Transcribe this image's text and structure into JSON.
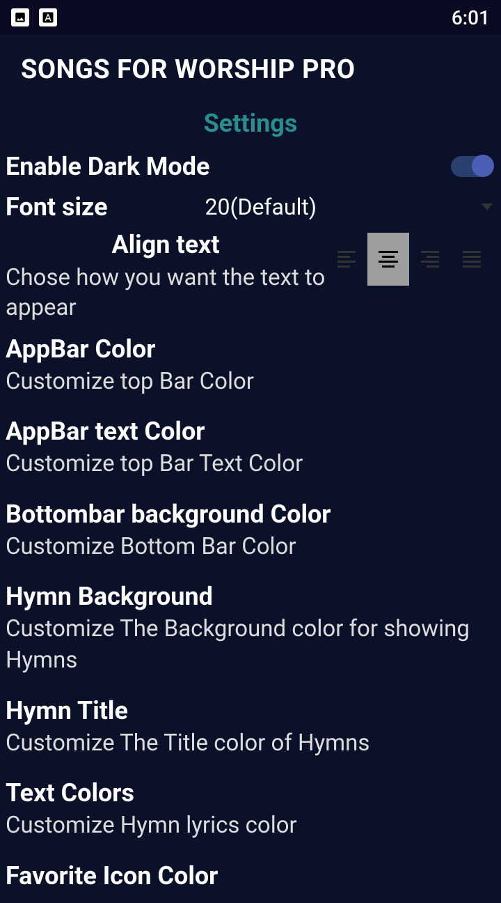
{
  "status": {
    "time": "6:01"
  },
  "app_title": "SONGS FOR WORSHIP PRO",
  "page_title": "Settings",
  "dark_mode": {
    "label": "Enable Dark Mode",
    "enabled": true
  },
  "font_size": {
    "label": "Font size",
    "value": "20(Default)"
  },
  "align": {
    "title": "Align text",
    "desc": "Chose how you want the text to appear",
    "selected": "center"
  },
  "sections": [
    {
      "title": "AppBar Color",
      "desc": "Customize top Bar Color"
    },
    {
      "title": "AppBar text Color",
      "desc": "Customize top Bar Text Color"
    },
    {
      "title": "Bottombar background Color",
      "desc": "Customize Bottom Bar Color"
    },
    {
      "title": "Hymn Background",
      "desc": "Customize The Background color for showing Hymns"
    },
    {
      "title": "Hymn Title",
      "desc": "Customize The Title color of Hymns"
    },
    {
      "title": "Text Colors",
      "desc": "Customize Hymn lyrics color"
    },
    {
      "title": "Favorite Icon Color",
      "desc": ""
    }
  ]
}
